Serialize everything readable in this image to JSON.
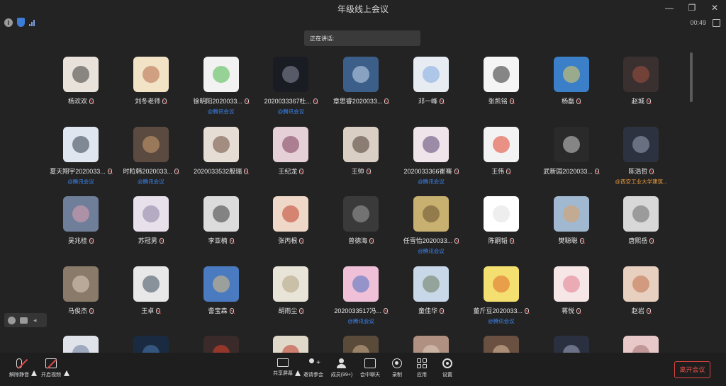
{
  "window": {
    "title": "年级线上会议"
  },
  "status": {
    "timer": "00:49"
  },
  "speaking": {
    "label": "正在讲话:"
  },
  "participants": [
    {
      "name": "杨欢欢",
      "tag": "",
      "c1": "#e8e2da",
      "c2": "#3a3a3a"
    },
    {
      "name": "刘冬老师",
      "tag": "",
      "c1": "#f3e3c6",
      "c2": "#b46a4a"
    },
    {
      "name": "徐明阳2020033...",
      "tag": "@腾讯会议",
      "c1": "#f2f2f2",
      "c2": "#4bb84b"
    },
    {
      "name": "2020033367杜...",
      "tag": "@腾讯会议",
      "c1": "#1a1c24",
      "c2": "#8a8fa0"
    },
    {
      "name": "章思睿2020033...",
      "tag": "",
      "c1": "#3c5f8a",
      "c2": "#c9d8f0"
    },
    {
      "name": "邓一峰",
      "tag": "",
      "c1": "#e7ecf2",
      "c2": "#7fa8e0"
    },
    {
      "name": "张凯铭",
      "tag": "",
      "c1": "#f5f5f5",
      "c2": "#2a2a2a"
    },
    {
      "name": "杨磊",
      "tag": "",
      "c1": "#3b7fc9",
      "c2": "#e8d05a"
    },
    {
      "name": "赵城",
      "tag": "",
      "c1": "#3a3030",
      "c2": "#a05040"
    },
    {
      "name": "夏天翔宇2020033...",
      "tag": "@腾讯会议",
      "c1": "#dfe6ef",
      "c2": "#2f3a4a"
    },
    {
      "name": "时粒韩2020033...",
      "tag": "@腾讯会议",
      "c1": "#5a4a40",
      "c2": "#d0a070"
    },
    {
      "name": "2020033532殷瑞",
      "tag": "",
      "c1": "#e6ddd4",
      "c2": "#6a4a3a"
    },
    {
      "name": "王纪龙",
      "tag": "",
      "c1": "#e6d0d8",
      "c2": "#7a3a5a"
    },
    {
      "name": "王帅",
      "tag": "",
      "c1": "#d9cfc4",
      "c2": "#4a3a30"
    },
    {
      "name": "2020033366崔骞",
      "tag": "@腾讯会议",
      "c1": "#efe4ea",
      "c2": "#5a4070"
    },
    {
      "name": "王伟",
      "tag": "",
      "c1": "#f3f3f3",
      "c2": "#e0402a"
    },
    {
      "name": "武新园2020033...",
      "tag": "",
      "c1": "#2a2a2a",
      "c2": "#d0d0d0"
    },
    {
      "name": "陈浩哲",
      "tag": "@西安工业大学建筑...",
      "c1": "#2c3240",
      "c2": "#9aa4b8"
    },
    {
      "name": "吴兆桂",
      "tag": "",
      "c1": "#6f7f9a",
      "c2": "#e0a0b0"
    },
    {
      "name": "苏冠男",
      "tag": "",
      "c1": "#e8e0ea",
      "c2": "#8a80a0"
    },
    {
      "name": "李亚楠",
      "tag": "",
      "c1": "#dcdcdc",
      "c2": "#3a3a3a"
    },
    {
      "name": "张丙根",
      "tag": "",
      "c1": "#efd8c8",
      "c2": "#c0402a"
    },
    {
      "name": "曾德海",
      "tag": "",
      "c1": "#3a3a3a",
      "c2": "#a0a0a0"
    },
    {
      "name": "任雪怡2020033...",
      "tag": "@腾讯会议",
      "c1": "#c8b070",
      "c2": "#6a5030"
    },
    {
      "name": "陈嗣韬",
      "tag": "",
      "c1": "#ffffff",
      "c2": "#e0e0e0"
    },
    {
      "name": "樊聪聪",
      "tag": "",
      "c1": "#a0b8d0",
      "c2": "#e0a060"
    },
    {
      "name": "唐熙岳",
      "tag": "",
      "c1": "#d8d8d8",
      "c2": "#6a6a6a"
    },
    {
      "name": "马俊杰",
      "tag": "",
      "c1": "#8a7a6a",
      "c2": "#e0d0c0"
    },
    {
      "name": "王卓",
      "tag": "",
      "c1": "#e8e8e8",
      "c2": "#3a4a5a"
    },
    {
      "name": "訾宝森",
      "tag": "",
      "c1": "#4a7ac0",
      "c2": "#e0c080"
    },
    {
      "name": "胡雨尘",
      "tag": "",
      "c1": "#e8e4d8",
      "c2": "#b0a080"
    },
    {
      "name": "2020033517冯...",
      "tag": "@腾讯会议",
      "c1": "#f0c0d8",
      "c2": "#4a70c0"
    },
    {
      "name": "童佳华",
      "tag": "",
      "c1": "#c8d8e8",
      "c2": "#6a7a5a"
    },
    {
      "name": "董斤豆2020033...",
      "tag": "@腾讯会议",
      "c1": "#f3e070",
      "c2": "#e06a2a"
    },
    {
      "name": "蒋悦",
      "tag": "",
      "c1": "#f6e6e6",
      "c2": "#e07a8a"
    },
    {
      "name": "赵岩",
      "tag": "",
      "c1": "#e8d0c0",
      "c2": "#c0704a"
    },
    {
      "name": "",
      "tag": "",
      "c1": "#e0e4ea",
      "c2": "#6a7a9a"
    },
    {
      "name": "",
      "tag": "",
      "c1": "#1a2a40",
      "c2": "#4a7ab0"
    },
    {
      "name": "",
      "tag": "",
      "c1": "#3a2a2a",
      "c2": "#e0402a"
    },
    {
      "name": "",
      "tag": "",
      "c1": "#e0d8c8",
      "c2": "#c03a2a"
    },
    {
      "name": "",
      "tag": "",
      "c1": "#5a4a3a",
      "c2": "#d0b090"
    },
    {
      "name": "",
      "tag": "",
      "c1": "#b09080",
      "c2": "#e0d0c0"
    },
    {
      "name": "",
      "tag": "",
      "c1": "#6a5040",
      "c2": "#e0c0a0"
    },
    {
      "name": "",
      "tag": "",
      "c1": "#2a3040",
      "c2": "#a0a8c0"
    },
    {
      "name": "",
      "tag": "",
      "c1": "#e8c8c8",
      "c2": "#a07070"
    }
  ],
  "toolbar": {
    "unmute": "解除静音",
    "start_video": "开启视频",
    "share_screen": "共享屏幕",
    "invite": "邀请参会",
    "members": "成员(99+)",
    "chat": "会中聊天",
    "record": "录制",
    "apps": "应用",
    "settings": "设置",
    "leave": "离开会议"
  },
  "colors": {
    "background": "#232323",
    "tag_blue": "#3a84f0",
    "tag_orange": "#e89a3a",
    "danger": "#e24a4a"
  }
}
